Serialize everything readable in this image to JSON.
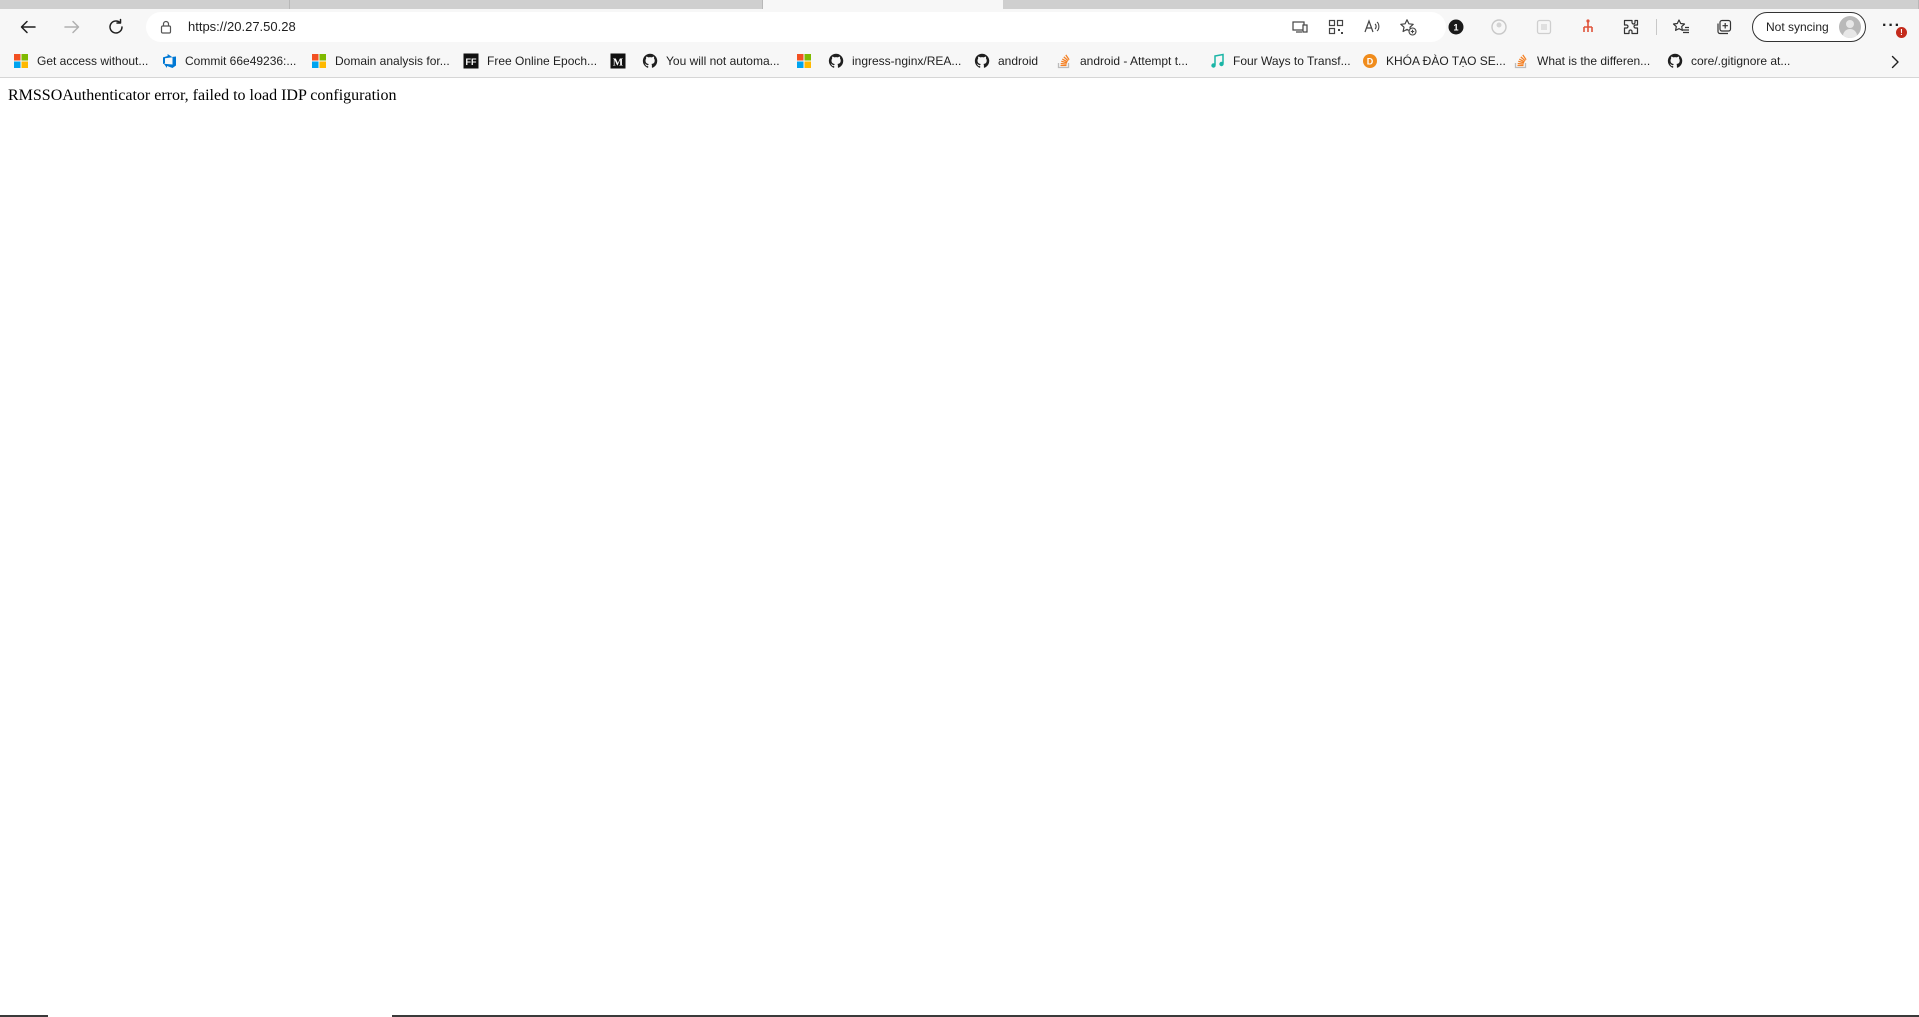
{
  "browser": {
    "tabs": [
      {
        "state": "inactive"
      },
      {
        "state": "inactive"
      },
      {
        "state": "active"
      },
      {
        "state": "inactive"
      }
    ],
    "address_bar": {
      "url": "https://20.27.50.28"
    },
    "toolbar_icons": [
      "back-icon",
      "forward-icon",
      "refresh-icon",
      "lock-icon",
      "app-available-icon",
      "qr-code-icon",
      "read-aloud-icon",
      "add-favorite-icon",
      "extension-1password-icon",
      "extension-grey-icon",
      "extension-square-icon",
      "extension-red-icon",
      "extensions-icon",
      "favorites-icon",
      "collections-icon"
    ],
    "profile": {
      "label": "Not syncing"
    },
    "menu": {
      "badge": "!"
    }
  },
  "bookmarks": [
    {
      "label": "Get access without...",
      "icon": "microsoft-icon"
    },
    {
      "label": "Commit 66e49236:...",
      "icon": "azure-devops-icon"
    },
    {
      "label": "Domain analysis for...",
      "icon": "microsoft-icon"
    },
    {
      "label": "Free Online Epoch...",
      "icon": "ff-icon"
    },
    {
      "label": "",
      "icon": "medium-icon"
    },
    {
      "label": "You will not automa...",
      "icon": "github-icon"
    },
    {
      "label": "",
      "icon": "microsoft-icon"
    },
    {
      "label": "ingress-nginx/REA...",
      "icon": "github-icon"
    },
    {
      "label": "android",
      "icon": "github-icon"
    },
    {
      "label": "android - Attempt t...",
      "icon": "stackoverflow-icon"
    },
    {
      "label": "Four Ways to Transf...",
      "icon": "music-note-icon"
    },
    {
      "label": "KHÓA ĐÀO TẠO SE...",
      "icon": "orange-d-icon"
    },
    {
      "label": "What is the differen...",
      "icon": "stackoverflow-icon"
    },
    {
      "label": "core/.gitignore at...",
      "icon": "github-icon"
    }
  ],
  "page": {
    "message": "RMSSOAuthenticator error, failed to load IDP configuration"
  },
  "colors": {
    "chrome_bg": "#f7f7f7",
    "tab_strip": "#dfdfdf",
    "badge": "#c42b1c",
    "github": "#1f1f1f",
    "stackoverflow": "#f48024"
  }
}
